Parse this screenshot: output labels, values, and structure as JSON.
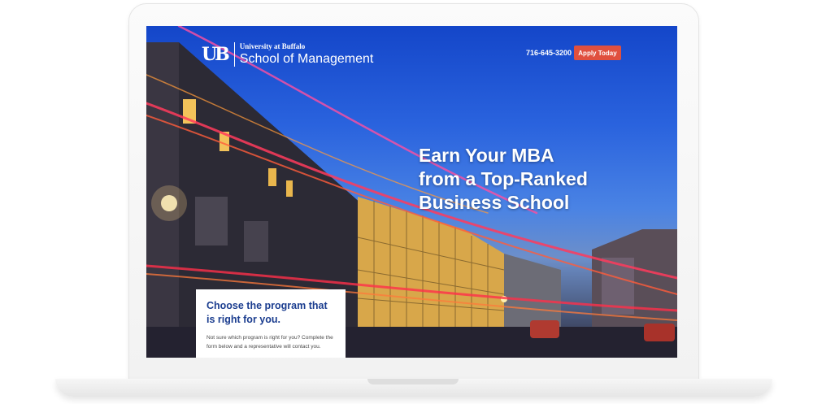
{
  "header": {
    "logo_mark": "UB",
    "logo_small": "University at Buffalo",
    "logo_large": "School of Management",
    "phone": "716-645-3200",
    "cta_label": "Apply Today",
    "cta_color": "#e0503e"
  },
  "hero": {
    "headline_lines": [
      "Earn Your MBA",
      "from a Top-Ranked",
      "Business School"
    ]
  },
  "form_card": {
    "title": "Choose the program that is right for you.",
    "subtitle": "Not sure which program is right for you? Complete the form below and a representative will contact you."
  },
  "colors": {
    "sky": "#2a63de",
    "title_blue": "#1b3d8f",
    "light_trail_red": "#ff3b5c"
  }
}
